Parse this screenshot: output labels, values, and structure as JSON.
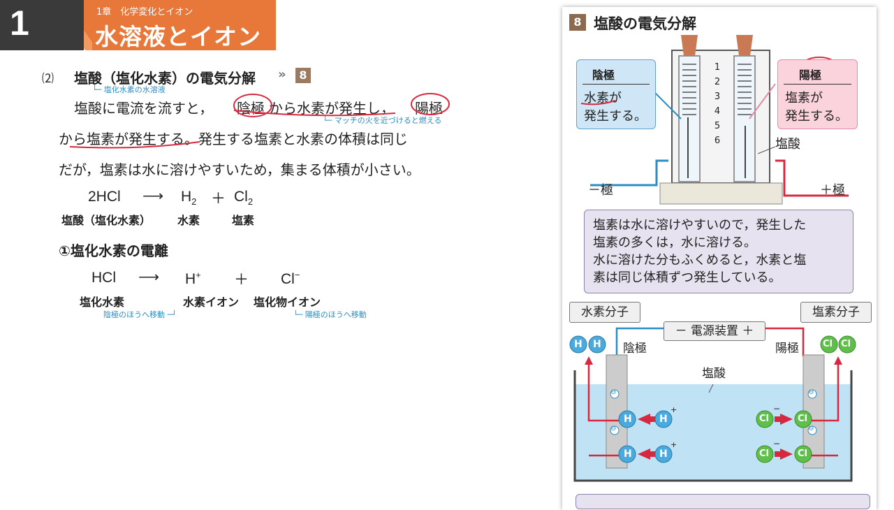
{
  "header": {
    "number": "1",
    "chapter": "1章　化学変化とイオン",
    "title": "水溶液とイオン"
  },
  "section": {
    "number": "⑵",
    "title": "塩酸（塩化水素）の電気分解",
    "ref_arrow": "»",
    "ref_number": "8",
    "note_hcl": "└─ 塩化水素の水溶液",
    "note_match": "└─ マッチの火を近づけると燃える",
    "line1a": "塩酸に電流を流すと，",
    "line1_cathode": "陰極",
    "line1b": "から水素が発生し，",
    "line1_anode": "陽極",
    "line2": "から塩素が発生する。発生する塩素と水素の体積は同じ",
    "line3": "だが，塩素は水に溶けやすいため，集まる体積が小さい。"
  },
  "equation1": {
    "reactant": "2HCl",
    "arrow": "⟶",
    "product1_base": "H",
    "product1_sub": "2",
    "plus": "＋",
    "product2_base": "Cl",
    "product2_sub": "2",
    "label_reactant": "塩酸（塩化水素）",
    "label_p1": "水素",
    "label_p2": "塩素"
  },
  "subsection": {
    "title": "①塩化水素の電離"
  },
  "equation2": {
    "reactant": "HCl",
    "arrow": "⟶",
    "product1": "H",
    "product1_sup": "+",
    "plus": "＋",
    "product2": "Cl",
    "product2_sup": "−",
    "label_reactant": "塩化水素",
    "label_p1": "水素イオン",
    "label_p2": "塩化物イオン",
    "note_cathode": "陰極のほうへ移動 ─┘",
    "note_anode": "└─ 陽極のほうへ移動"
  },
  "figure": {
    "number": "8",
    "title": "塩酸の電気分解",
    "cathode_box": {
      "title": "陰極",
      "line1": "水素が",
      "line2": "発生する。"
    },
    "anode_box": {
      "title": "陽極",
      "line1": "塩素が",
      "line2": "発生する。"
    },
    "scale": [
      "1",
      "2",
      "3",
      "4",
      "5",
      "6"
    ],
    "hcl_label": "塩酸",
    "neg_label": "－極",
    "pos_label": "＋極",
    "explain": [
      "塩素は水に溶けやすいので，発生した",
      "塩素の多くは，水に溶ける。",
      "水に溶けた分もふくめると，水素と塩",
      "素は同じ体積ずつ発生している。"
    ],
    "h2_molecule": "水素分子",
    "cl2_molecule": "塩素分子",
    "power_supply": "－ 電源装置 ＋",
    "cathode_label": "陰極",
    "anode_label": "陽極",
    "solution_label": "塩酸",
    "h": "H",
    "cl": "Cl",
    "plus": "+",
    "minus": "−",
    "electron": "⊖"
  },
  "colors": {
    "header_orange": "#e8773a",
    "header_dark": "#3a3a3a",
    "annotation_red": "#d6283f",
    "note_blue": "#2a8ec5",
    "h_ion": "#4aa9dd",
    "cl_ion": "#5ec04a"
  }
}
